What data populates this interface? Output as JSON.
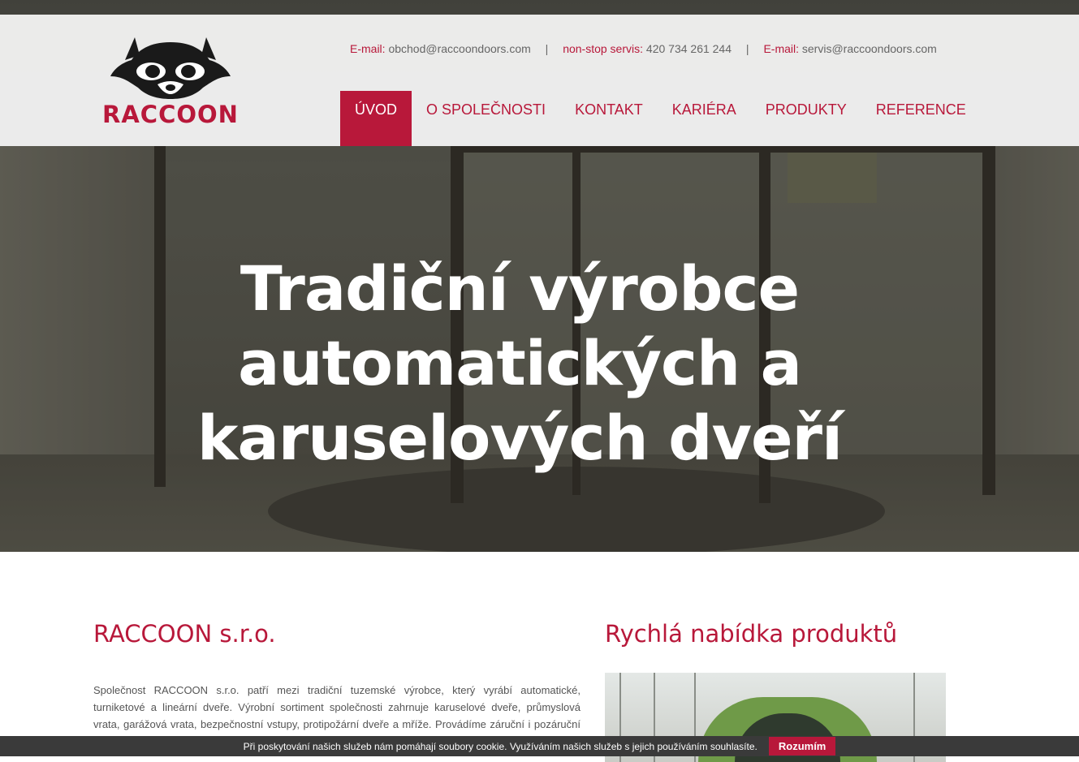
{
  "brand": {
    "name": "RACCOON",
    "accent": "#b8183a"
  },
  "contact": {
    "email_label": "E-mail:",
    "email": "obchod@raccoondoors.com",
    "service_label": "non-stop servis:",
    "service_phone": "420 734 261 244",
    "email2_label": "E-mail:",
    "email2": "servis@raccoondoors.com",
    "separator": "|"
  },
  "nav": {
    "items": [
      {
        "label": "ÚVOD",
        "active": true
      },
      {
        "label": "O SPOLEČNOSTI"
      },
      {
        "label": "KONTAKT"
      },
      {
        "label": "KARIÉRA"
      },
      {
        "label": "PRODUKTY"
      },
      {
        "label": "REFERENCE"
      }
    ]
  },
  "hero": {
    "line1": "Tradiční výrobce",
    "line2": "automatických a",
    "line3": "karuselových dveří"
  },
  "about": {
    "title": "RACCOON s.r.o.",
    "text": "Společnost RACCOON s.r.o. patří mezi tradiční tuzemské výrobce, který vyrábí automatické, turniketové a lineární dveře. Výrobní sortiment společnosti zahrnuje karuselové dveře, průmyslová vrata, garážová vrata, bezpečnostní vstupy, protipožární dveře a mříže. Provádíme záruční i pozáruční servis."
  },
  "products": {
    "title": "Rychlá nabídka produktů"
  },
  "cookie": {
    "text": "Při poskytování našich služeb nám pomáhají soubory cookie. Využíváním našich služeb s jejich používáním souhlasíte.",
    "button": "Rozumím"
  }
}
